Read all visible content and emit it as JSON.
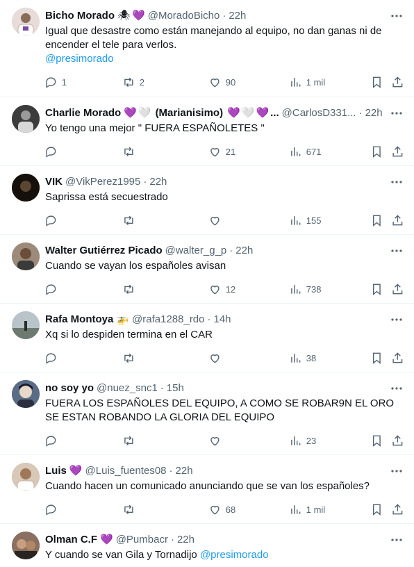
{
  "tweets": [
    {
      "name": "Bicho Morado",
      "badges": [
        "🕷",
        "💜"
      ],
      "handle": "@MoradoBicho",
      "time": "22h",
      "text": "Igual que desastre como están manejando al equipo, no dan ganas ni de encender el tele para verlos.",
      "mention": "@presimorado",
      "replies": "1",
      "retweets": "2",
      "likes": "90",
      "views": "1 mil",
      "avatar_color": "#d9c7c4"
    },
    {
      "name": "Charlie Morado",
      "badges": [
        "💜",
        "🤍",
        "(Marianisimo)",
        "💜",
        "🤍",
        "💜",
        "..."
      ],
      "handle": "@CarlosD331...",
      "time": "22h",
      "text": "Yo tengo una mejor \" FUERA ESPAÑOLETES \"",
      "replies": "",
      "retweets": "",
      "likes": "21",
      "views": "671",
      "avatar_color": "#4a4a4a"
    },
    {
      "name": "VIK",
      "handle": "@VikPerez1995",
      "time": "22h",
      "text": "Saprissa está secuestrado",
      "replies": "",
      "retweets": "",
      "likes": "",
      "views": "155",
      "avatar_color": "#1a1410"
    },
    {
      "name": "Walter Gutiérrez Picado",
      "handle": "@walter_g_p",
      "time": "22h",
      "text": "Cuando se vayan los españoles avisan",
      "replies": "",
      "retweets": "",
      "likes": "12",
      "views": "738",
      "avatar_color": "#7a6350"
    },
    {
      "name": "Rafa Montoya",
      "badges": [
        "🚁"
      ],
      "handle": "@rafa1288_rdo",
      "time": "14h",
      "text": "Xq si lo despiden termina en el CAR",
      "replies": "",
      "retweets": "",
      "likes": "",
      "views": "38",
      "avatar_color": "#8fa0a8"
    },
    {
      "name": "no soy yo",
      "handle": "@nuez_snc1",
      "time": "15h",
      "text": "FUERA LOS ESPAÑOLES DEL EQUIPO, A COMO SE ROBAR9N EL ORO SE ESTAN ROBANDO LA GLORIA DEL EQUIPO",
      "replies": "",
      "retweets": "",
      "likes": "",
      "views": "23",
      "avatar_color": "#3b4658"
    },
    {
      "name": "Luis",
      "badges": [
        "💜"
      ],
      "handle": "@Luis_fuentes08",
      "time": "22h",
      "text": "Cuando hacen un comunicado anunciando que se van los españoles?",
      "replies": "",
      "retweets": "",
      "likes": "68",
      "views": "1 mil",
      "avatar_color": "#b49a86"
    },
    {
      "name": "Olman C.F",
      "badges": [
        "💜"
      ],
      "handle": "@Pumbacr",
      "time": "22h",
      "text": "Y cuando se van Gila y Tornadijo",
      "mention": "@presimorado",
      "avatar_color": "#6e5a4e"
    }
  ]
}
